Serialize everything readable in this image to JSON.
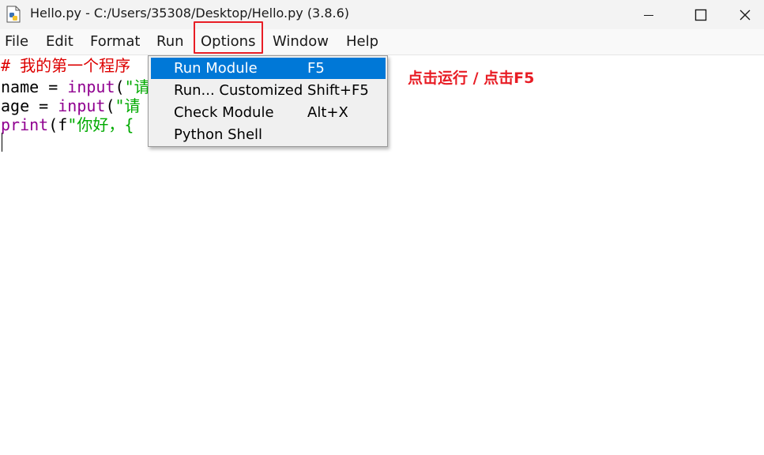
{
  "window": {
    "title": "Hello.py - C:/Users/35308/Desktop/Hello.py (3.8.6)",
    "icon": "python-file-icon",
    "controls": [
      "minimize-icon",
      "maximize-icon",
      "close-icon"
    ]
  },
  "menubar": {
    "items": [
      {
        "label": "File"
      },
      {
        "label": "Edit"
      },
      {
        "label": "Format"
      },
      {
        "label": "Run"
      },
      {
        "label": "Options"
      },
      {
        "label": "Window"
      },
      {
        "label": "Help"
      }
    ],
    "open_menu": "Run",
    "highlighted": "Options"
  },
  "run_menu": {
    "items": [
      {
        "label": "Run Module",
        "shortcut": "F5",
        "active": true
      },
      {
        "label": "Run... Customized",
        "shortcut": "Shift+F5",
        "active": false
      },
      {
        "label": "Check Module",
        "shortcut": "Alt+X",
        "active": false
      },
      {
        "label": "Python Shell",
        "shortcut": "",
        "active": false
      }
    ]
  },
  "editor": {
    "lines": [
      {
        "tokens": [
          {
            "text": "# 我的第一个程序",
            "kind": "comment"
          }
        ]
      },
      {
        "tokens": [
          {
            "text": "name = ",
            "kind": "plain"
          },
          {
            "text": "input",
            "kind": "builtin"
          },
          {
            "text": "(",
            "kind": "plain"
          },
          {
            "text": "\"请",
            "kind": "string"
          }
        ]
      },
      {
        "tokens": [
          {
            "text": "age = ",
            "kind": "plain"
          },
          {
            "text": "input",
            "kind": "builtin"
          },
          {
            "text": "(",
            "kind": "plain"
          },
          {
            "text": "\"请",
            "kind": "string"
          }
        ]
      },
      {
        "tokens": [
          {
            "text": "print",
            "kind": "builtin"
          },
          {
            "text": "(f",
            "kind": "plain"
          },
          {
            "text": "\"你好，{",
            "kind": "string"
          }
        ]
      }
    ]
  },
  "annotation": {
    "text": "点击运行 / 点击F5",
    "color": "#e81d25"
  },
  "colors": {
    "accent": "#0078d7",
    "highlight_box": "#e81d25",
    "comment": "#dd0000",
    "builtin": "#900090",
    "string": "#00aa00"
  }
}
